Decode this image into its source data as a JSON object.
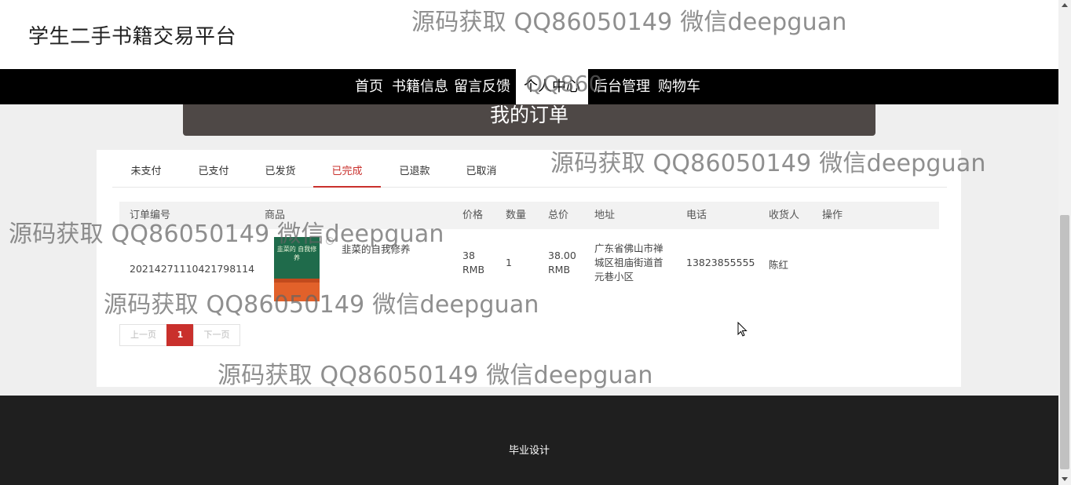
{
  "site": {
    "title": "学生二手书籍交易平台"
  },
  "nav": {
    "items": [
      {
        "label": "首页"
      },
      {
        "label": "书籍信息"
      },
      {
        "label": "留言反馈"
      },
      {
        "label": "个人中心"
      },
      {
        "label": "后台管理"
      },
      {
        "label": "购物车"
      }
    ],
    "active": "个人中心"
  },
  "banner": {
    "title": "我的订单"
  },
  "tabs": {
    "items": [
      {
        "label": "未支付"
      },
      {
        "label": "已支付"
      },
      {
        "label": "已发货"
      },
      {
        "label": "已完成"
      },
      {
        "label": "已退款"
      },
      {
        "label": "已取消"
      }
    ],
    "active": "已完成"
  },
  "table": {
    "headers": [
      "订单编号",
      "商品",
      "价格",
      "数量",
      "总价",
      "地址",
      "电话",
      "收货人",
      "操作"
    ],
    "rows": [
      {
        "order_id": "20214271110421798114",
        "product": "韭菜的自我修养",
        "cover_title": "韭菜的 自我修养",
        "price": "38 RMB",
        "quantity": "1",
        "total": "38.00 RMB",
        "address": "广东省佛山市禅城区祖庙街道首元巷小区",
        "phone": "13823855555",
        "receiver": "陈红",
        "action": ""
      }
    ]
  },
  "pagination": {
    "prev": "上一页",
    "current": "1",
    "next": "下一页"
  },
  "footer": {
    "text": "毕业设计"
  },
  "watermark": {
    "text": "源码获取 QQ86050149 微信deepguan",
    "fragment": "QQ860"
  },
  "colors": {
    "accent": "#c9302c",
    "nav_bg": "#000000",
    "banner_bg": "#4e4846",
    "footer_bg": "#1f1f1f"
  }
}
